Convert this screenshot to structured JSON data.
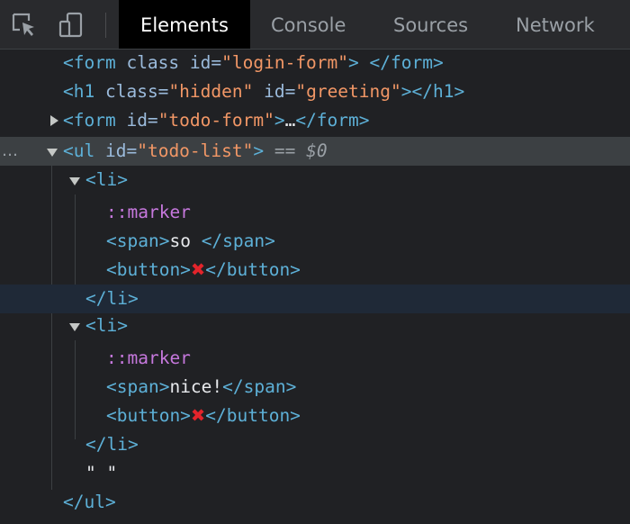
{
  "toolbar": {
    "tabs": [
      {
        "label": "Elements",
        "active": true
      },
      {
        "label": "Console",
        "active": false
      },
      {
        "label": "Sources",
        "active": false
      },
      {
        "label": "Network",
        "active": false
      }
    ]
  },
  "dom_tree": {
    "form_login_open": "<form",
    "form_login_attr1": "class",
    "form_login_attr2": "id=",
    "form_login_val": "\"login-form\"",
    "form_login_close": "> </form>",
    "h1_open": "<h1",
    "h1_attr1": "class=",
    "h1_val1": "\"hidden\"",
    "h1_attr2": "id=",
    "h1_val2": "\"greeting\"",
    "h1_close": "></h1>",
    "form_todo_open": "<form",
    "form_todo_attr": "id=",
    "form_todo_val": "\"todo-form\"",
    "form_todo_close1": ">",
    "form_todo_ellipsis": "…",
    "form_todo_close2": "</form>",
    "ul_open": "<ul",
    "ul_attr": "id=",
    "ul_val": "\"todo-list\"",
    "ul_close": ">",
    "ul_ref_eq": "==",
    "ul_ref": "$0",
    "li1_open": "<li>",
    "li1_marker": "::marker",
    "li1_span_open": "<span>",
    "li1_span_text": "so ",
    "li1_span_close": "</span>",
    "li1_button_open": "<button>",
    "li1_button_text": "✖",
    "li1_button_close": "</button>",
    "li1_close": "</li>",
    "li2_open": "<li>",
    "li2_marker": "::marker",
    "li2_span_open": "<span>",
    "li2_span_text": "nice!",
    "li2_span_close": "</span>",
    "li2_button_open": "<button>",
    "li2_button_text": "✖",
    "li2_button_close": "</button>",
    "li2_close": "</li>",
    "text_node": "\" \"",
    "ul_end": "</ul>",
    "ellipsis_dots": "…"
  },
  "colors": {
    "tag": "#5db0d7",
    "attribute": "#9bbbdc",
    "value": "#f29766",
    "pseudo": "#c678dd",
    "delete_mark": "#e3242b"
  }
}
